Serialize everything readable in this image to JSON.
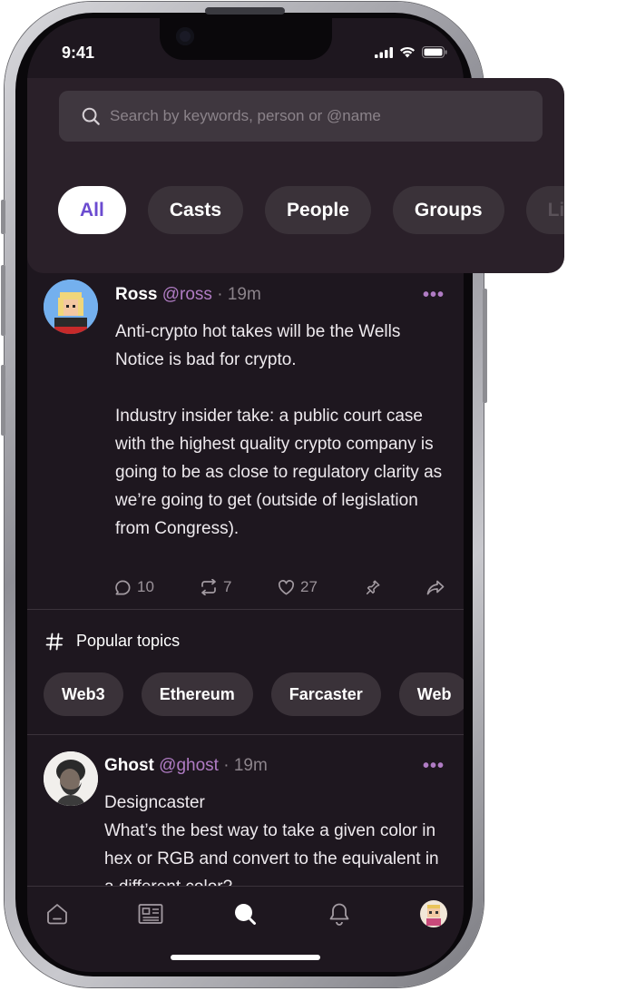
{
  "status_bar": {
    "time": "9:41"
  },
  "search": {
    "placeholder": "Search by keywords, person or @name"
  },
  "filters": [
    {
      "label": "All",
      "active": true
    },
    {
      "label": "Casts",
      "active": false
    },
    {
      "label": "People",
      "active": false
    },
    {
      "label": "Groups",
      "active": false
    },
    {
      "label": "Lists",
      "active": false
    }
  ],
  "post1": {
    "name": "Ross",
    "handle": "@ross",
    "separator": " · ",
    "time": "19m",
    "paragraph1": "Anti-crypto hot takes will be the Wells Notice is bad for crypto.",
    "paragraph2": "Industry insider take: a public court case with the highest quality crypto company is going to be as close to regulatory clarity as we’re going to get (outside of legislation from Congress).",
    "replies": "10",
    "recasts": "7",
    "likes": "27"
  },
  "topics": {
    "heading": "Popular topics",
    "items": [
      "Web3",
      "Ethereum",
      "Farcaster",
      "Web"
    ]
  },
  "post2": {
    "name": "Ghost",
    "handle": "@ghost",
    "separator": " · ",
    "time": "19m",
    "line1": "Designcaster",
    "line2": "What’s the best way to take a given color in hex or RGB and convert to the equivalent in a different color?"
  },
  "colors": {
    "accent": "#b07cc4",
    "background": "#1e171f",
    "chip": "#3a3239"
  },
  "icons": [
    "search-icon",
    "comment-icon",
    "recast-icon",
    "heart-icon",
    "pin-icon",
    "share-icon",
    "hash-icon",
    "home-icon",
    "news-icon",
    "search-tab-icon",
    "bell-icon",
    "profile-avatar"
  ]
}
